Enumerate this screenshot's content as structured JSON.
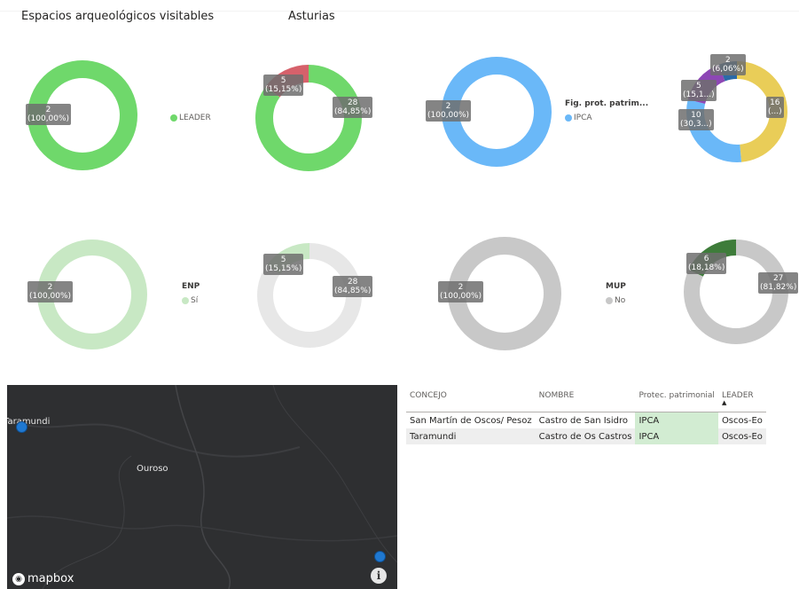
{
  "header": {
    "title": "Espacios arqueológicos visitables",
    "region": "Asturias"
  },
  "colors": {
    "leader_green": "#6fd86b",
    "red": "#d6616b",
    "ipca_blue": "#6ab8f8",
    "yellow": "#e9cd58",
    "purple": "#8d47b5",
    "dark_blue": "#2b6aa8",
    "enp_light_green": "#c8e8c4",
    "grey_light": "#e7e7e7",
    "grey_mid": "#c8c8c8",
    "dark_green": "#3e7c3a"
  },
  "donuts": [
    {
      "id": "leader-local",
      "slices": [
        {
          "value": 2,
          "color": "#6fd86b"
        }
      ],
      "labels": [
        {
          "count": "2",
          "pct": "(100,00%)"
        }
      ]
    },
    {
      "id": "leader-asturias",
      "slices": [
        {
          "value": 28,
          "color": "#6fd86b"
        },
        {
          "value": 5,
          "color": "#d6616b"
        }
      ],
      "labels": [
        {
          "count": "5",
          "pct": "(15,15%)"
        },
        {
          "count": "28",
          "pct": "(84,85%)"
        }
      ]
    },
    {
      "id": "figprot-local",
      "slices": [
        {
          "value": 2,
          "color": "#6ab8f8"
        }
      ],
      "labels": [
        {
          "count": "2",
          "pct": "(100,00%)"
        }
      ]
    },
    {
      "id": "figprot-asturias",
      "slices": [
        {
          "value": 16,
          "color": "#e9cd58"
        },
        {
          "value": 10,
          "color": "#6ab8f8"
        },
        {
          "value": 5,
          "color": "#8d47b5"
        },
        {
          "value": 2,
          "color": "#2b6aa8"
        }
      ],
      "labels": [
        {
          "count": "2",
          "pct": "(6,06%)"
        },
        {
          "count": "5",
          "pct": "(15,1...)"
        },
        {
          "count": "10",
          "pct": "(30,3...)"
        },
        {
          "count": "16",
          "pct": "(...)"
        }
      ]
    },
    {
      "id": "enp-local",
      "slices": [
        {
          "value": 2,
          "color": "#c8e8c4"
        }
      ],
      "labels": [
        {
          "count": "2",
          "pct": "(100,00%)"
        }
      ]
    },
    {
      "id": "enp-asturias",
      "slices": [
        {
          "value": 28,
          "color": "#e7e7e7"
        },
        {
          "value": 5,
          "color": "#c8e8c4"
        }
      ],
      "labels": [
        {
          "count": "5",
          "pct": "(15,15%)"
        },
        {
          "count": "28",
          "pct": "(84,85%)"
        }
      ]
    },
    {
      "id": "mup-local",
      "slices": [
        {
          "value": 2,
          "color": "#c8c8c8"
        }
      ],
      "labels": [
        {
          "count": "2",
          "pct": "(100,00%)"
        }
      ]
    },
    {
      "id": "mup-asturias",
      "slices": [
        {
          "value": 27,
          "color": "#c8c8c8"
        },
        {
          "value": 6,
          "color": "#3e7c3a"
        }
      ],
      "labels": [
        {
          "count": "6",
          "pct": "(18,18%)"
        },
        {
          "count": "27",
          "pct": "(81,82%)"
        }
      ]
    }
  ],
  "legends": {
    "leader": {
      "title": "",
      "item": "LEADER",
      "color": "#6fd86b"
    },
    "figprot": {
      "title": "Fig. prot. patrim...",
      "item": "IPCA",
      "color": "#6ab8f8"
    },
    "enp": {
      "title": "ENP",
      "item": "Sí",
      "color": "#c8e8c4"
    },
    "mup": {
      "title": "MUP",
      "item": "No",
      "color": "#c8c8c8"
    }
  },
  "map": {
    "towns": [
      "Taramundi",
      "Ouroso"
    ],
    "brand": "mapbox",
    "info_glyph": "i"
  },
  "table": {
    "columns": [
      "CONCEJO",
      "NOMBRE",
      "Protec. patrimonial",
      "LEADER"
    ],
    "sort_column": "LEADER",
    "rows": [
      [
        "San Martín de Oscos/ Pesoz",
        "Castro de San Isidro",
        "IPCA",
        "Oscos-Eo"
      ],
      [
        "Taramundi",
        "Castro de Os Castros",
        "IPCA",
        "Oscos-Eo"
      ]
    ]
  }
}
